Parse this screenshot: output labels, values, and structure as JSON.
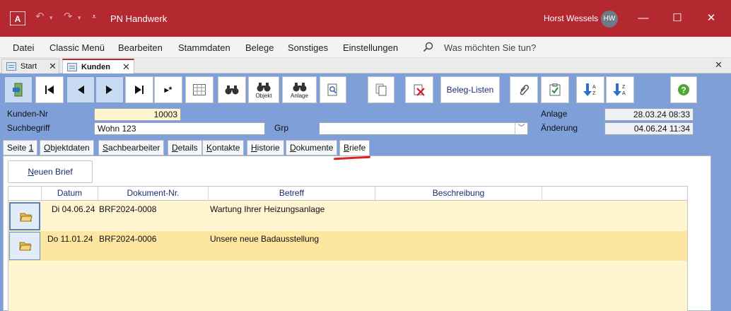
{
  "window": {
    "title": "PN Handwerk",
    "user_name": "Horst Wessels",
    "user_initials": "HW",
    "controls": {
      "minimize": "—",
      "maximize": "☐",
      "close": "✕"
    }
  },
  "menu": {
    "items": [
      "Datei",
      "Classic Menü",
      "Bearbeiten",
      "Stammdaten",
      "Belege",
      "Sonstiges",
      "Einstellungen"
    ],
    "search_placeholder": "Was möchten Sie tun?"
  },
  "doc_tabs": [
    {
      "label": "Start",
      "active": false
    },
    {
      "label": "Kunden",
      "active": true
    }
  ],
  "toolbar": {
    "objekt_label": "Objekt",
    "anlage_label": "Anlage",
    "beleg_listen_label": "Beleg-Listen",
    "new_record_label": "▸*"
  },
  "header": {
    "kunden_nr_label": "Kunden-Nr",
    "kunden_nr_value": "10003",
    "suchbegriff_label": "Suchbegriff",
    "suchbegriff_value": "Wohn 123",
    "grp_label": "Grp",
    "grp_value": "",
    "anlage_label": "Anlage",
    "anlage_value": "28.03.24 08:33",
    "aenderung_label": "Änderung",
    "aenderung_value": "04.06.24 11:34"
  },
  "sub_tabs": [
    {
      "pre": "Seite ",
      "acc": "1",
      "post": ""
    },
    {
      "pre": "",
      "acc": "O",
      "post": "bjektdaten"
    },
    {
      "pre": "",
      "acc": "S",
      "post": "achbearbeiter"
    },
    {
      "pre": "",
      "acc": "D",
      "post": "etails"
    },
    {
      "pre": "",
      "acc": "K",
      "post": "ontakte"
    },
    {
      "pre": "",
      "acc": "H",
      "post": "istorie"
    },
    {
      "pre": "",
      "acc": "D",
      "post": "okumente"
    },
    {
      "pre": "",
      "acc": "B",
      "post": "riefe"
    }
  ],
  "briefe": {
    "new_button_pre": "",
    "new_button_acc": "N",
    "new_button_post": "euen Brief",
    "columns": [
      "Datum",
      "Dokument-Nr.",
      "Betreff",
      "Beschreibung"
    ],
    "rows": [
      {
        "datum": "Di 04.06.24",
        "dok_nr": "BRF2024-0008",
        "betreff": "Wartung Ihrer Heizungsanlage",
        "beschreibung": ""
      },
      {
        "datum": "Do 11.01.24",
        "dok_nr": "BRF2024-0006",
        "betreff": "Unsere neue Badausstellung",
        "beschreibung": ""
      }
    ]
  },
  "colors": {
    "titlebar": "#b4282f",
    "form_background": "#7e9fd8",
    "record_background": "#fff5d1",
    "selected_row": "#fde6a0",
    "annotation_underline": "#e0201e"
  }
}
